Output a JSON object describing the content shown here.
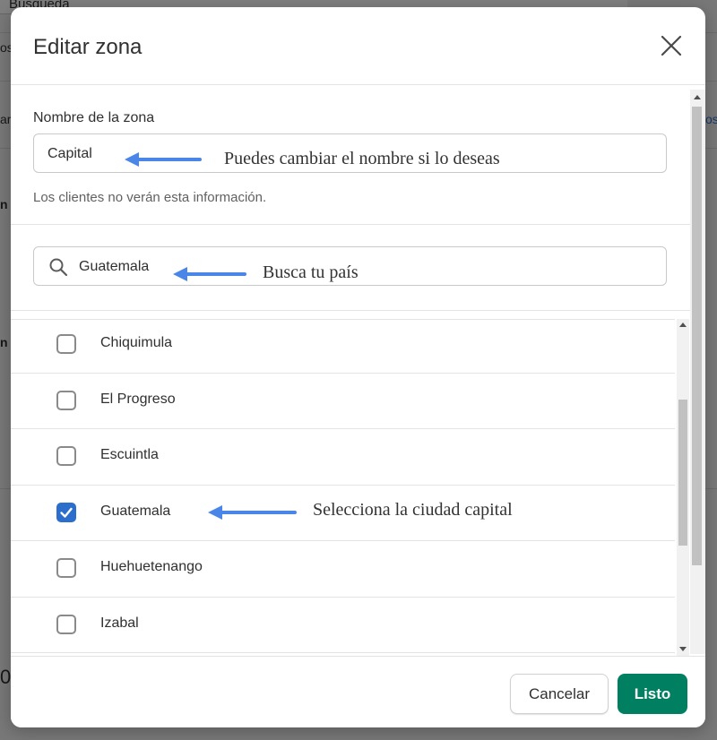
{
  "background": {
    "search_text": "Búsqueda",
    "fragments": [
      "os",
      "ar",
      "n",
      "n",
      "os",
      "0"
    ]
  },
  "modal": {
    "title": "Editar zona",
    "zone_name_label": "Nombre de la zona",
    "zone_name_value": "Capital",
    "help_text": "Los clientes no verán esta información.",
    "search_value": "Guatemala",
    "annotations": {
      "zone_name": "Puedes cambiar el nombre si lo deseas",
      "search": "Busca tu país",
      "select": "Selecciona la ciudad capital"
    },
    "list": [
      {
        "label": "Chiquimula",
        "checked": false
      },
      {
        "label": "El Progreso",
        "checked": false
      },
      {
        "label": "Escuintla",
        "checked": false
      },
      {
        "label": "Guatemala",
        "checked": true
      },
      {
        "label": "Huehuetenango",
        "checked": false
      },
      {
        "label": "Izabal",
        "checked": false
      }
    ],
    "cancel_label": "Cancelar",
    "done_label": "Listo"
  },
  "colors": {
    "primary": "#008060",
    "checkbox_checked": "#2c6ecb",
    "annotation_arrow": "#4a86e8"
  },
  "icons": [
    "close-icon",
    "search-icon",
    "checkmark-icon",
    "arrow-left-icon"
  ]
}
